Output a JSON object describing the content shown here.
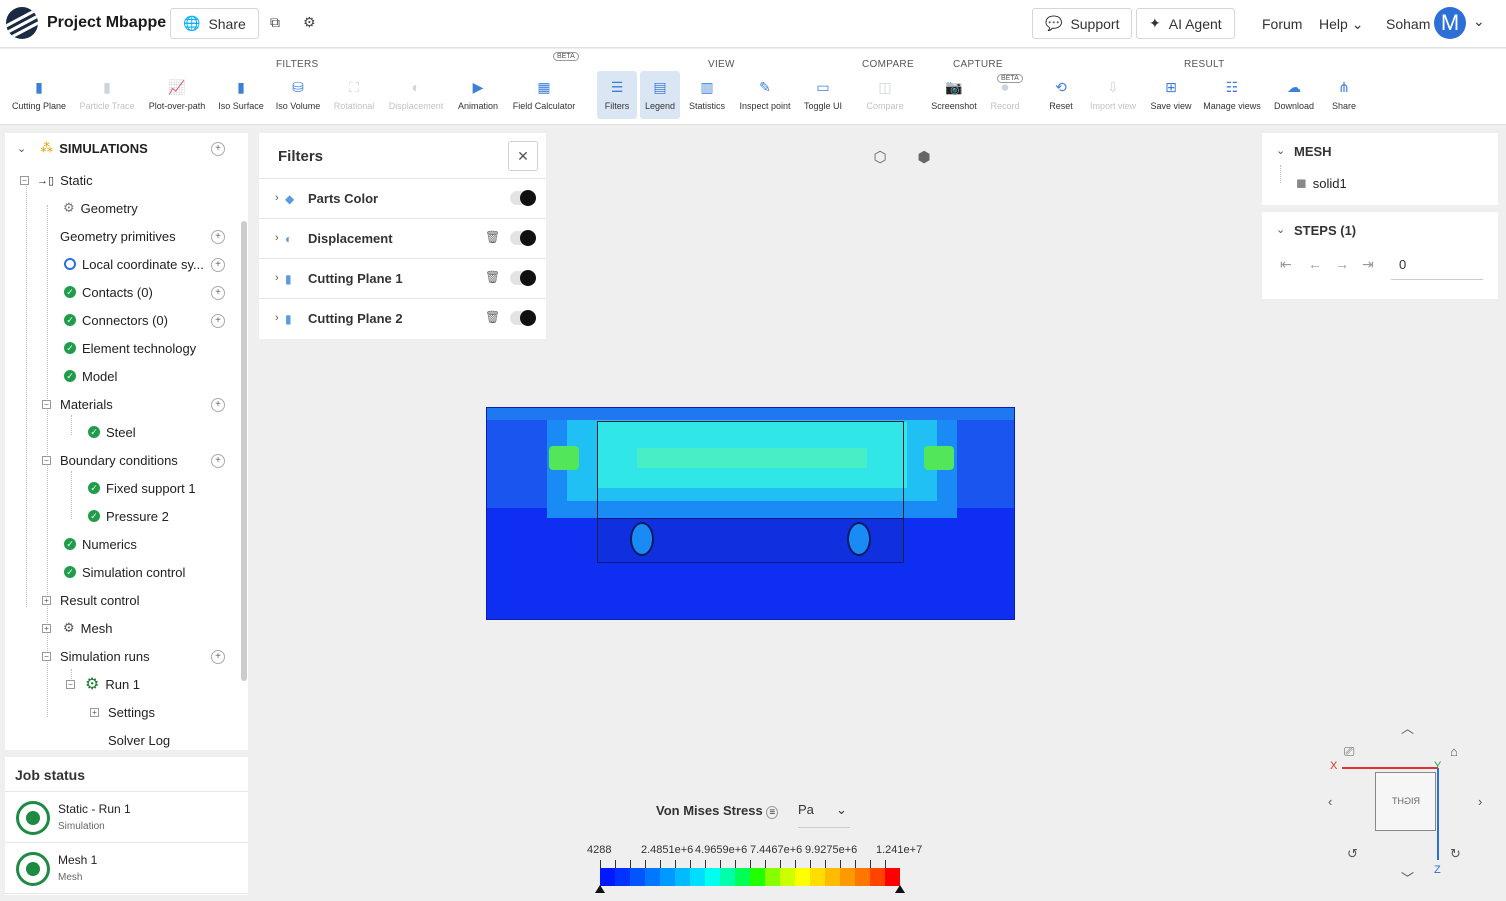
{
  "header": {
    "project_title": "Project Mbappe",
    "share_label": "Share",
    "support_label": "Support",
    "ai_agent_label": "AI Agent",
    "forum_label": "Forum",
    "help_label": "Help",
    "user_name": "Soham",
    "avatar_initial": "M"
  },
  "toolbar": {
    "groups": {
      "filters": "FILTERS",
      "view": "VIEW",
      "compare": "COMPARE",
      "capture": "CAPTURE",
      "result": "RESULT"
    },
    "beta_badge": "BETA",
    "tools": {
      "cutting_plane": "Cutting Plane",
      "particle_trace": "Particle Trace",
      "plot_over_path": "Plot-over-path",
      "iso_surface": "Iso Surface",
      "iso_volume": "Iso Volume",
      "rotational": "Rotational",
      "displacement": "Displacement",
      "animation": "Animation",
      "field_calculator": "Field Calculator",
      "filters": "Filters",
      "legend": "Legend",
      "statistics": "Statistics",
      "inspect_point": "Inspect point",
      "toggle_ui": "Toggle UI",
      "compare": "Compare",
      "screenshot": "Screenshot",
      "record": "Record",
      "reset": "Reset",
      "import_view": "Import view",
      "save_view": "Save view",
      "manage_views": "Manage views",
      "download": "Download",
      "share": "Share"
    }
  },
  "tree": {
    "root": "SIMULATIONS",
    "static": "Static",
    "geometry": "Geometry",
    "geometry_primitives": "Geometry primitives",
    "local_coordinate": "Local coordinate sy...",
    "contacts": "Contacts (0)",
    "connectors": "Connectors (0)",
    "element_technology": "Element technology",
    "model": "Model",
    "materials": "Materials",
    "steel": "Steel",
    "boundary_conditions": "Boundary conditions",
    "fixed_support": "Fixed support 1",
    "pressure": "Pressure 2",
    "numerics": "Numerics",
    "simulation_control": "Simulation control",
    "result_control": "Result control",
    "mesh": "Mesh",
    "simulation_runs": "Simulation runs",
    "run1": "Run 1",
    "settings": "Settings",
    "solver_log": "Solver Log"
  },
  "job_status": {
    "title": "Job status",
    "jobs": [
      {
        "title": "Static - Run 1",
        "subtitle": "Simulation"
      },
      {
        "title": "Mesh 1",
        "subtitle": "Mesh"
      }
    ]
  },
  "filters_panel": {
    "title": "Filters",
    "rows": [
      {
        "label": "Parts Color"
      },
      {
        "label": "Displacement"
      },
      {
        "label": "Cutting Plane 1"
      },
      {
        "label": "Cutting Plane 2"
      }
    ]
  },
  "right_panel": {
    "mesh_title": "MESH",
    "mesh_item": "solid1",
    "steps_title": "STEPS (1)",
    "step_value": "0"
  },
  "legend": {
    "title": "Von Mises Stress",
    "unit": "Pa",
    "ticks": [
      "4288",
      "2.4851e+6",
      "4.9659e+6",
      "7.4467e+6",
      "9.9275e+6",
      "1.241e+7"
    ],
    "colors": [
      "#0019ff",
      "#0033ff",
      "#0055ff",
      "#0077ff",
      "#0099ff",
      "#00bbff",
      "#00ddff",
      "#00ffee",
      "#00ffaa",
      "#00ff55",
      "#22ff00",
      "#88ff00",
      "#ccff00",
      "#ffff00",
      "#ffdd00",
      "#ffbb00",
      "#ff9900",
      "#ff7700",
      "#ff4400",
      "#ff0000"
    ]
  },
  "nav_cube": {
    "face_label": "RIGHT",
    "x_axis": "X",
    "y_axis": "Y",
    "z_axis": "Z"
  }
}
